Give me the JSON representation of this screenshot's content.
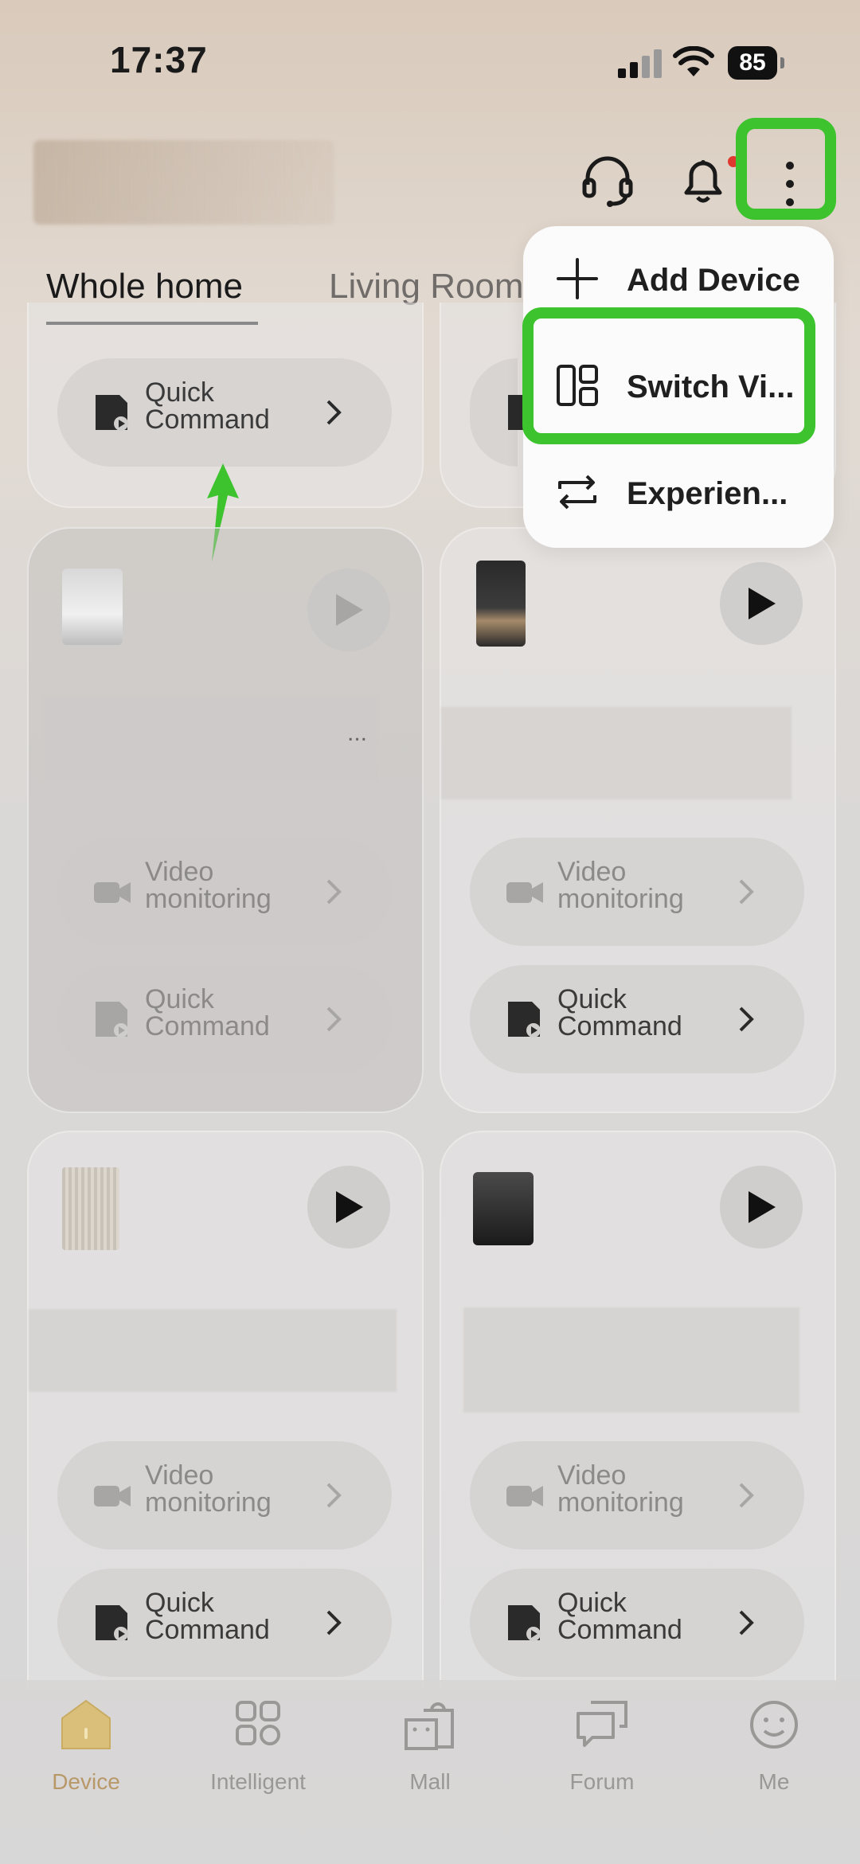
{
  "status_bar": {
    "time": "17:37",
    "battery": "85"
  },
  "tabs": {
    "active": "Whole home",
    "inactive": "Living Room"
  },
  "menu": {
    "items": [
      {
        "label": "Add Device",
        "icon": "plus-icon"
      },
      {
        "label": "Switch Vi...",
        "icon": "switch-view-icon"
      },
      {
        "label": "Experien...",
        "icon": "swap-icon"
      }
    ]
  },
  "cards": {
    "top_left": {
      "quick_command": "Quick\nCommand"
    },
    "mid_left": {
      "more": "...",
      "video": "Video\nmonitoring",
      "quick_command": "Quick\nCommand"
    },
    "mid_right": {
      "video": "Video\nmonitoring",
      "quick_command": "Quick\nCommand"
    },
    "bot_left": {
      "video": "Video\nmonitoring",
      "quick_command": "Quick\nCommand"
    },
    "bot_right": {
      "video": "Video\nmonitoring",
      "quick_command": "Quick\nCommand"
    }
  },
  "nav": {
    "items": [
      {
        "label": "Device",
        "active": true
      },
      {
        "label": "Intelligent",
        "active": false
      },
      {
        "label": "Mall",
        "active": false
      },
      {
        "label": "Forum",
        "active": false
      },
      {
        "label": "Me",
        "active": false
      }
    ]
  },
  "colors": {
    "highlight": "#3cc32d",
    "accent": "#b89868",
    "notification": "#e0392f"
  }
}
